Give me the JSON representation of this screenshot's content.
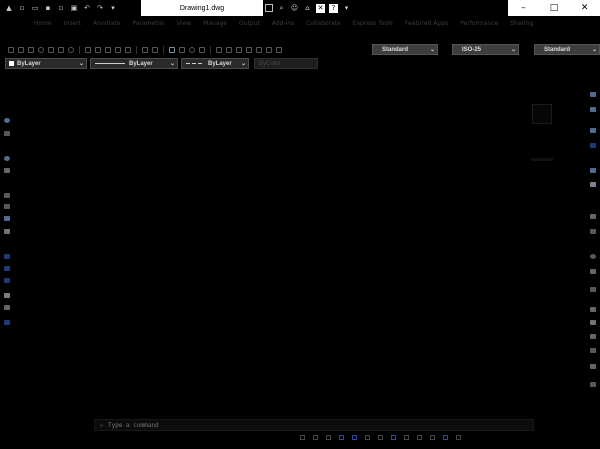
{
  "window": {
    "document_title": "Drawing1.dwg",
    "controls": {
      "minimize": "–",
      "maximize": "□",
      "close": "✕"
    }
  },
  "quick_access": {
    "icons": [
      "app-menu-icon",
      "new-icon",
      "open-icon",
      "save-icon",
      "save-as-icon",
      "print-icon",
      "undo-icon",
      "redo-icon",
      "dropdown-icon"
    ]
  },
  "ribbon": {
    "tabs": [
      "Home",
      "Insert",
      "Annotate",
      "Parametric",
      "View",
      "Manage",
      "Output",
      "Add-ins",
      "Collaborate",
      "Express Tools",
      "Featured Apps",
      "Performance",
      "Sharing"
    ]
  },
  "styles": {
    "text_style": "Standard",
    "dim_style": "ISO-25",
    "table_style": "Standard"
  },
  "properties": {
    "layer": "ByLayer",
    "linetype": "ByLayer",
    "lineweight": "ByLayer",
    "plotstyle": "ByColor"
  },
  "command_line": {
    "placeholder": "Type a command"
  },
  "colors": {
    "background": "#000000",
    "accent": "#2a4c9a",
    "combo_bg": "#3e3e3e"
  }
}
